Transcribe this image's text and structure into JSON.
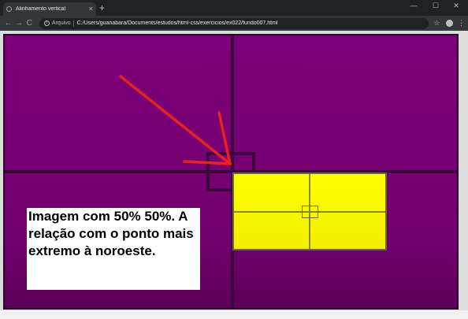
{
  "browser": {
    "tab_title": "Alinhamento vertical",
    "tab_close": "×",
    "new_tab": "+",
    "window_controls": {
      "minimize": "—",
      "maximize": "☐",
      "close": "✕"
    },
    "nav": {
      "back": "←",
      "forward": "→",
      "reload": "C"
    },
    "address": {
      "scheme_label": "Arquivo",
      "url": "C:/Users/guanabara/Documents/estudos/html-css/exercicios/ex022/fundo007.html"
    },
    "icons": [
      "info-icon",
      "star-icon",
      "profile-icon",
      "menu-icon"
    ]
  },
  "page": {
    "caption": "Imagem com 50% 50%. A relação com o ponto mais extremo à noroeste.",
    "colors": {
      "container_bg": "#7c0079",
      "guide_lines": "#3a0a3c",
      "yellow_image": "#ffff00",
      "arrow": "#e8221f",
      "caption_bg": "#ffffff"
    }
  }
}
